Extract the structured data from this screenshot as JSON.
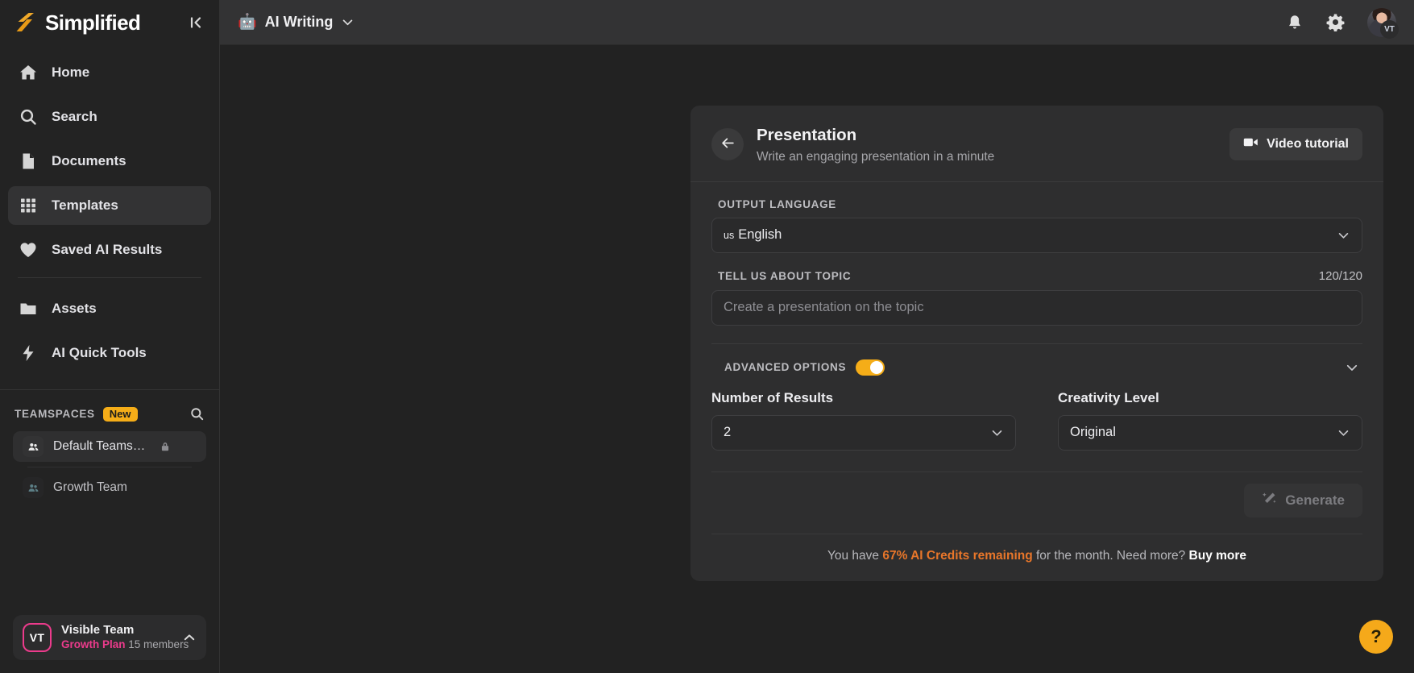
{
  "brand": {
    "name": "Simplified",
    "logo_color": "#f0a92a",
    "collapse_icon": "collapse-sidebar-icon"
  },
  "sidebar": {
    "items": [
      {
        "label": "Home",
        "icon": "home-icon",
        "active": false
      },
      {
        "label": "Search",
        "icon": "search-icon",
        "active": false
      },
      {
        "label": "Documents",
        "icon": "document-icon",
        "active": false
      },
      {
        "label": "Templates",
        "icon": "grid-icon",
        "active": true
      },
      {
        "label": "Saved AI Results",
        "icon": "heart-icon",
        "active": false
      },
      {
        "label": "Assets",
        "icon": "folder-icon",
        "active": false
      },
      {
        "label": "AI Quick Tools",
        "icon": "lightning-icon",
        "active": false
      }
    ],
    "teamspaces": {
      "title": "TEAMSPACES",
      "badge": "New",
      "badge_color": "#f5ad18",
      "search_icon": "search-icon",
      "items": [
        {
          "label": "Default Teams…",
          "icon": "people-icon",
          "locked": true,
          "active": true
        },
        {
          "label": "Growth Team",
          "icon": "people-icon",
          "locked": false,
          "active": false
        }
      ]
    },
    "user_card": {
      "initials": "VT",
      "name": "Visible Team",
      "plan": "Growth Plan",
      "members": "15 members",
      "accent": "#ec3b8c",
      "chevron": "chevron-up-icon"
    }
  },
  "topbar": {
    "app_emoji": "🤖",
    "app_name": "AI Writing",
    "app_chevron": "chevron-down-icon",
    "notifications_icon": "bell-icon",
    "settings_icon": "gear-icon",
    "avatar_badge": "VT"
  },
  "card": {
    "back_icon": "arrow-left-icon",
    "title": "Presentation",
    "subtitle": "Write an engaging presentation in a minute",
    "video_button": "Video tutorial",
    "video_icon": "video-camera-icon",
    "output_language": {
      "label": "OUTPUT LANGUAGE",
      "country_code": "us",
      "value": "English"
    },
    "topic": {
      "label": "TELL US ABOUT TOPIC",
      "counter": "120/120",
      "value": "",
      "placeholder": "Create a presentation on the topic"
    },
    "advanced": {
      "label": "ADVANCED OPTIONS",
      "toggle_on": true,
      "toggle_color": "#f5ad18",
      "chevron": "chevron-down-icon",
      "number_of_results": {
        "label": "Number of Results",
        "value": "2"
      },
      "creativity_level": {
        "label": "Creativity Level",
        "value": "Original"
      }
    },
    "generate": {
      "label": "Generate",
      "icon": "magic-wand-icon",
      "disabled": true
    },
    "credits": {
      "prefix": "You have ",
      "highlight": "67% AI Credits remaining",
      "middle": " for the month. Need more? ",
      "link": "Buy more",
      "highlight_color": "#e8762a"
    }
  },
  "help": {
    "label": "?",
    "color": "#f5a91a"
  }
}
